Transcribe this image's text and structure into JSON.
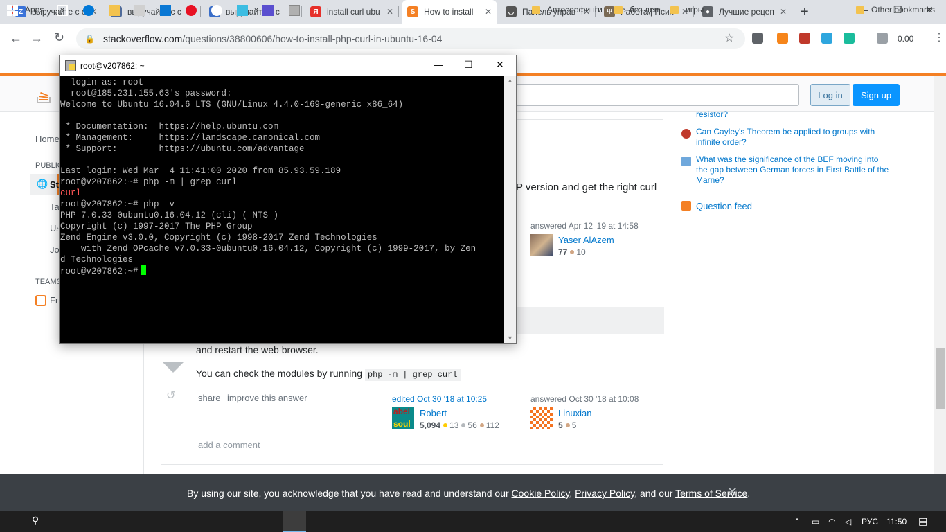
{
  "browser": {
    "tabs": [
      {
        "label": "выручайте с с",
        "icon": "Z",
        "color": "#3b73d9"
      },
      {
        "label": "выручайте с с",
        "icon": "V",
        "color": "#4f6b9a"
      },
      {
        "label": "выручайте с с",
        "icon": "★",
        "color": "#3a6ec8"
      },
      {
        "label": "install curl ubu",
        "icon": "Я",
        "color": "#e6302a"
      },
      {
        "label": "How to install",
        "icon": "S",
        "color": "#f48024"
      },
      {
        "label": "Панель управ",
        "icon": "◡",
        "color": "#555555"
      },
      {
        "label": "Работа | Псих",
        "icon": "Ψ",
        "color": "#7a6a55"
      },
      {
        "label": "Лучшие рецеп",
        "icon": "●",
        "color": "#5f6368"
      }
    ],
    "url_host": "stackoverflow.com",
    "url_path": "/questions/38800606/how-to-install-php-curl-in-ubuntu-16-04",
    "ext_counter": "0.00",
    "bookmarks": {
      "apps": "Apps",
      "autosurf": "Автосерфинги",
      "bezdep": "без деп",
      "games": "игры",
      "other": "Other bookmarks"
    }
  },
  "so": {
    "login": "Log in",
    "signup": "Sign up",
    "nav": {
      "home": "Home",
      "public": "PUBLIC",
      "so": "St",
      "tags": "Ta",
      "users": "Us",
      "jobs": "Jo",
      "teams": "TEAMS",
      "free": "Fr"
    },
    "answer1": {
      "text_tail": "P version and get the right curl",
      "answered": "answered Apr 12 '19 at 14:58",
      "user": "Yaser AlAzem",
      "rep": "77",
      "bronze": "10"
    },
    "answer2": {
      "restart": "and restart the web browser.",
      "check_prefix": "You can check the modules by running",
      "check_code": "php -m | grep curl",
      "share": "share",
      "improve": "improve this answer",
      "edited": "edited Oct 30 '18 at 10:25",
      "editor": "Robert",
      "editor_rep": "5,094",
      "editor_gold": "13",
      "editor_silver": "56",
      "editor_bronze": "112",
      "answered": "answered Oct 30 '18 at 10:08",
      "user": "Linuxian",
      "user_rep": "5",
      "user_bronze": "5",
      "add_comment": "add a comment"
    },
    "sidebar": {
      "resistor": "resistor?",
      "cayley": "Can Cayley's Theorem be applied to groups with infinite order?",
      "bef": "What was the significance of the BEF moving into the gap between German forces in First Battle of the Marne?",
      "feed": "Question feed"
    },
    "cookie": {
      "prefix": "By using our site, you acknowledge that you have read and understand our",
      "cookie_policy": "Cookie Policy",
      "comma": ",",
      "privacy_policy": "Privacy Policy",
      "and_our": ", and our",
      "terms": "Terms of Service",
      "dot": "."
    }
  },
  "putty": {
    "title": "root@v207862: ~",
    "lines": [
      "  login as: root",
      "  root@185.231.155.63's password:",
      "Welcome to Ubuntu 16.04.6 LTS (GNU/Linux 4.4.0-169-generic x86_64)",
      "",
      " * Documentation:  https://help.ubuntu.com",
      " * Management:     https://landscape.canonical.com",
      " * Support:        https://ubuntu.com/advantage",
      "",
      "Last login: Wed Mar  4 11:41:00 2020 from 85.93.59.189",
      "root@v207862:~# php -m | grep curl"
    ],
    "curl_line": "curl",
    "lines2": [
      "root@v207862:~# php -v",
      "PHP 7.0.33-0ubuntu0.16.04.12 (cli) ( NTS )",
      "Copyright (c) 1997-2017 The PHP Group",
      "Zend Engine v3.0.0, Copyright (c) 1998-2017 Zend Technologies",
      "    with Zend OPcache v7.0.33-0ubuntu0.16.04.12, Copyright (c) 1999-2017, by Zen",
      "d Technologies"
    ],
    "prompt": "root@v207862:~#"
  },
  "taskbar": {
    "lang": "РУС",
    "time": "11:50"
  }
}
